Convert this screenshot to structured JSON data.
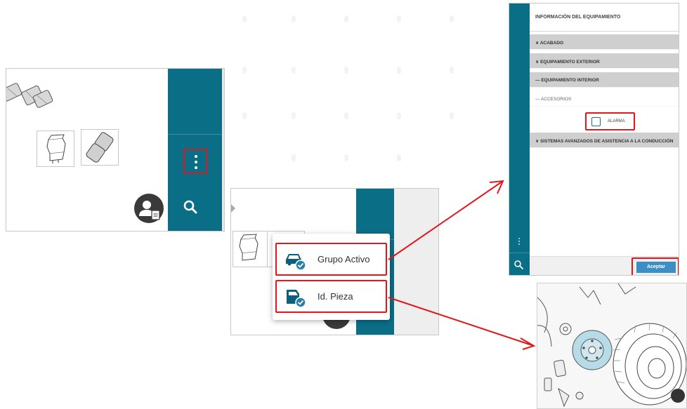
{
  "menu": {
    "items": [
      {
        "label": "Grupo Activo",
        "icon": "car-check-icon"
      },
      {
        "label": "Id. Pieza",
        "icon": "door-check-icon"
      }
    ]
  },
  "equipment_panel": {
    "title": "INFORMACIÓN DEL EQUIPAMIENTO",
    "sections": [
      {
        "label": "ACABADO",
        "state": "collapsed"
      },
      {
        "label": "EQUIPAMIENTO EXTERIOR",
        "state": "collapsed"
      },
      {
        "label": "EQUIPAMIENTO INTERIOR",
        "state": "expanded"
      },
      {
        "label": "ACCESORIOS",
        "state": "expanded"
      },
      {
        "label": "SISTEMAS AVANZADOS DE ASISTENCIA A LA CONDUCCIÓN",
        "state": "collapsed"
      }
    ],
    "checkbox_label": "ALARMA",
    "accept_label": "Aceptar"
  },
  "colors": {
    "rail": "#0b6e87",
    "highlight": "#e3161b",
    "accept_button": "#3b8fc4"
  }
}
